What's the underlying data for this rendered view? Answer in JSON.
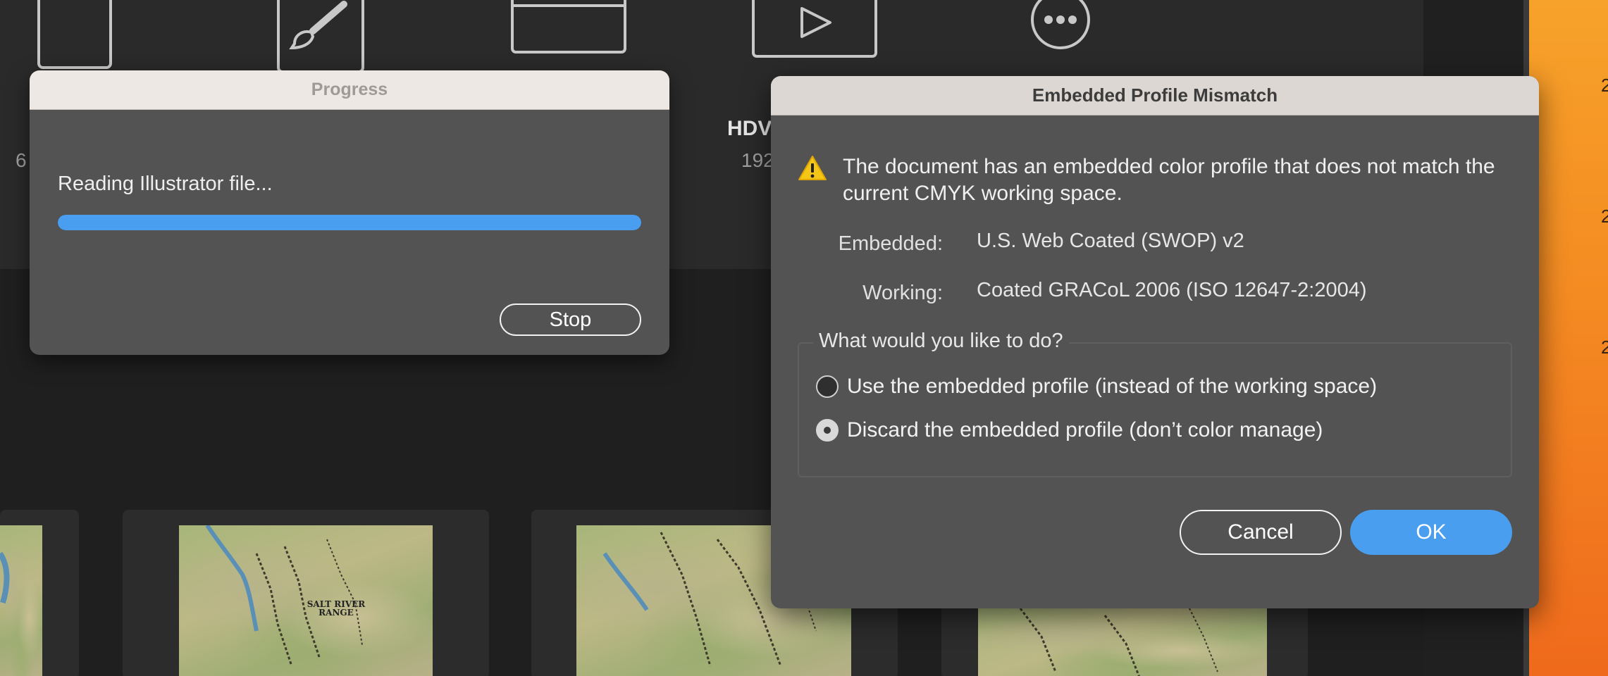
{
  "background": {
    "presets": [
      {
        "name": "",
        "dim": "6"
      },
      {
        "name": "HDV",
        "dim": "192"
      }
    ],
    "wallpaper_numbers": [
      "2",
      "2",
      "2"
    ],
    "thumbnail_label": "SALT RIVER RANGE"
  },
  "progress_dialog": {
    "title": "Progress",
    "message": "Reading Illustrator file...",
    "progress_fraction": 1.0,
    "stop_label": "Stop"
  },
  "mismatch_dialog": {
    "title": "Embedded Profile Mismatch",
    "warning_icon": "warning-triangle-icon",
    "message": "The document has an embedded color profile that does not match the current CMYK working space.",
    "embedded_label": "Embedded:",
    "embedded_value": "U.S. Web Coated (SWOP) v2",
    "working_label": "Working:",
    "working_value": "Coated GRACoL 2006 (ISO 12647-2:2004)",
    "question": "What would you like to do?",
    "options": [
      {
        "label": "Use the embedded profile (instead of the working space)",
        "selected": false
      },
      {
        "label": "Discard the embedded profile (don’t color manage)",
        "selected": true
      }
    ],
    "cancel_label": "Cancel",
    "ok_label": "OK"
  },
  "colors": {
    "accent": "#4a9ef0",
    "dialog_bg": "#535353",
    "app_bg": "#1f1f1f"
  }
}
